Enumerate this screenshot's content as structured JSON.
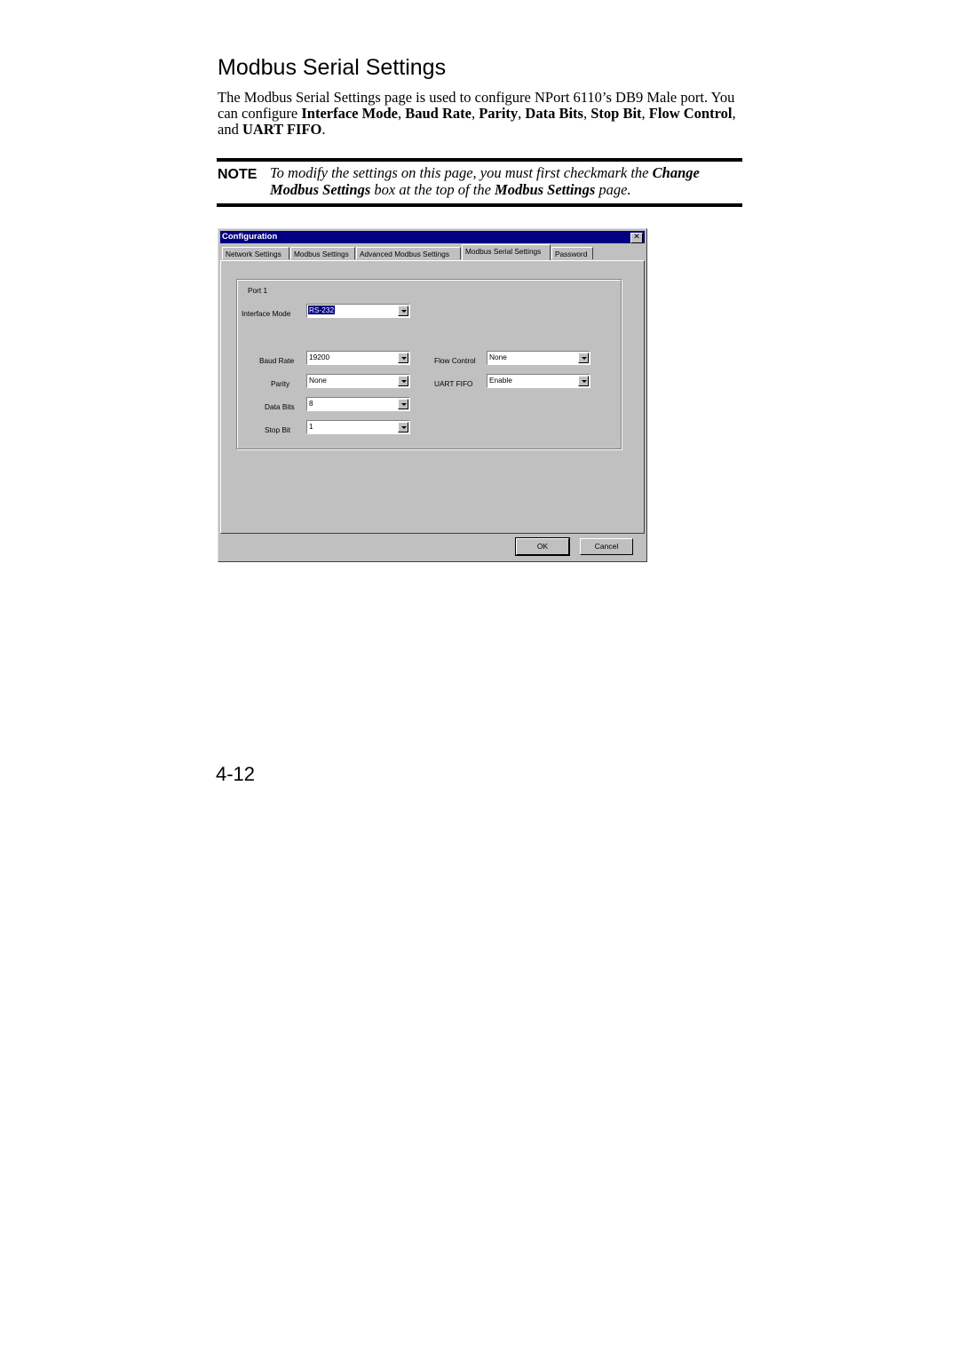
{
  "heading": "Modbus Serial Settings",
  "intro": {
    "text_1": "The Modbus Serial Settings page is used to configure NPort 6110’s DB9 Male port. You can configure ",
    "b1": "Interface Mode",
    "s1": ", ",
    "b2": "Baud Rate",
    "s2": ", ",
    "b3": "Parity",
    "s3": ", ",
    "b4": "Data Bits",
    "s4": ", ",
    "b5": "Stop Bit",
    "s5": ", ",
    "b6": "Flow Control",
    "s6": ", and ",
    "b7": "UART FIFO",
    "s7": "."
  },
  "note": {
    "label": "NOTE",
    "t1": "To modify the settings on this page, you must first checkmark the ",
    "b1": "Change Modbus Settings",
    "t2": " box at the top of the ",
    "b2": "Modbus Settings",
    "t3": " page."
  },
  "dialog": {
    "title": "Configuration",
    "close_glyph": "✕",
    "tabs": [
      {
        "label": "Network Settings",
        "active": false
      },
      {
        "label": "Modbus Settings",
        "active": false
      },
      {
        "label": "Advanced Modbus Settings",
        "active": false
      },
      {
        "label": "Modbus Serial Settings",
        "active": true
      },
      {
        "label": "Password",
        "active": false
      }
    ],
    "group_label": "Port 1",
    "fields": {
      "interface_mode": {
        "label": "Interface Mode",
        "value": "RS-232"
      },
      "baud_rate": {
        "label": "Baud Rate",
        "value": "19200"
      },
      "parity": {
        "label": "Parity",
        "value": "None"
      },
      "data_bits": {
        "label": "Data Bits",
        "value": "8"
      },
      "stop_bit": {
        "label": "Stop Bit",
        "value": "1"
      },
      "flow_control": {
        "label": "Flow Control",
        "value": "None"
      },
      "uart_fifo": {
        "label": "UART FIFO",
        "value": "Enable"
      }
    },
    "ok_label": "OK",
    "cancel_label": "Cancel",
    "colors": {
      "titlebar": "#000080",
      "face": "#c0c0c0"
    }
  },
  "page_number": "4-12"
}
